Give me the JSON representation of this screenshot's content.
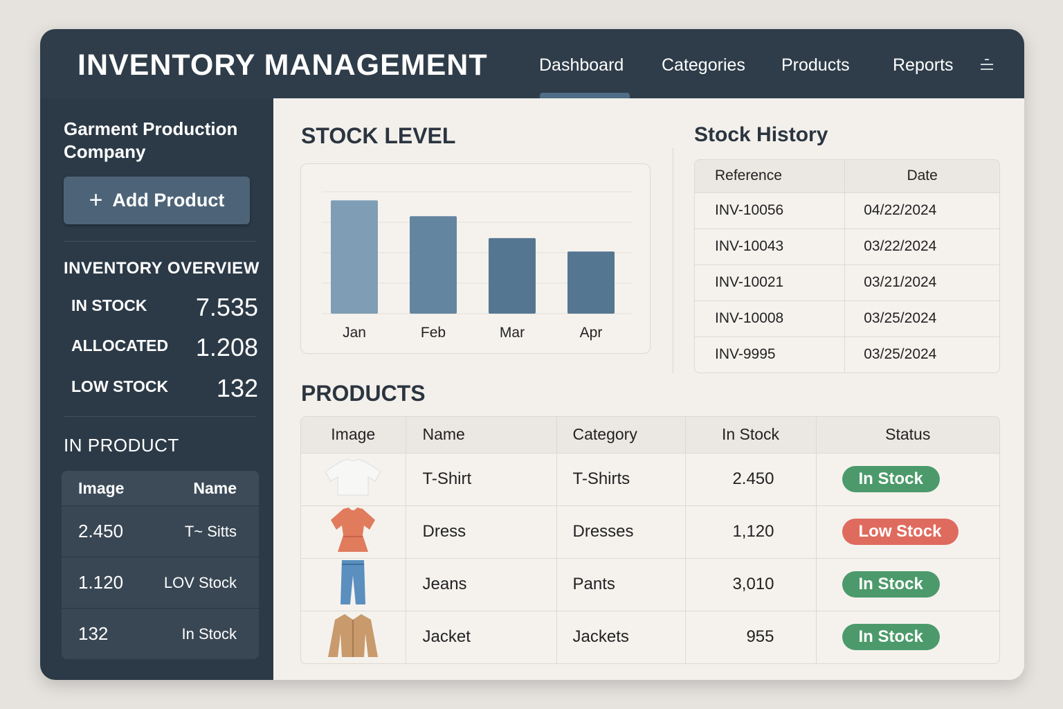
{
  "header": {
    "title": "INVENTORY MANAGEMENT",
    "nav": [
      "Dashboard",
      "Categories",
      "Products",
      "Reports"
    ],
    "active": "Dashboard"
  },
  "sidebar": {
    "company": "Garment Production Company",
    "add_button": "Add Product",
    "overview_title": "INVENTORY OVERVIEW",
    "overview": [
      {
        "label": "IN STOCK",
        "value": "7.535"
      },
      {
        "label": "ALLOCATED",
        "value": "1.208"
      },
      {
        "label": "LOW STOCK",
        "value": "132"
      }
    ],
    "in_product_title": "IN PRODUCT",
    "in_product_headers": [
      "Image",
      "Name"
    ],
    "in_product_rows": [
      [
        "2.450",
        "T~ Sitts"
      ],
      [
        "1.120",
        "LOV Stock"
      ],
      [
        "132",
        "In Stock"
      ]
    ]
  },
  "stock_level": {
    "title": "STOCK LEVEL"
  },
  "chart_data": {
    "type": "bar",
    "categories": [
      "Jan",
      "Feb",
      "Mar",
      "Apr"
    ],
    "values": [
      93,
      80,
      62,
      51
    ],
    "ylim": [
      0,
      100
    ],
    "grid": true,
    "colors": [
      "#7f9db5",
      "#6485a0",
      "#557690",
      "#557690"
    ]
  },
  "history": {
    "title": "Stock History",
    "headers": [
      "Reference",
      "Date"
    ],
    "rows": [
      [
        "INV-10056",
        "04/22/2024"
      ],
      [
        "INV-10043",
        "03/22/2024"
      ],
      [
        "INV-10021",
        "03/21/2024"
      ],
      [
        "INV-10008",
        "03/25/2024"
      ],
      [
        "INV-9995",
        "03/25/2024"
      ]
    ]
  },
  "products": {
    "title": "PRODUCTS",
    "headers": [
      "Image",
      "Name",
      "Category",
      "In Stock",
      "Status"
    ],
    "rows": [
      {
        "name": "T-Shirt",
        "category": "T-Shirts",
        "stock": "2.450",
        "status": "In Stock",
        "color": "#4c9a6b"
      },
      {
        "name": "Dress",
        "category": "Dresses",
        "stock": "1,120",
        "status": "Low Stock",
        "color": "#df6b5e"
      },
      {
        "name": "Jeans",
        "category": "Pants",
        "stock": "3,010",
        "status": "In Stock",
        "color": "#4c9a6b"
      },
      {
        "name": "Jacket",
        "category": "Jackets",
        "stock": "955",
        "status": "In Stock",
        "color": "#4c9a6b"
      }
    ]
  }
}
